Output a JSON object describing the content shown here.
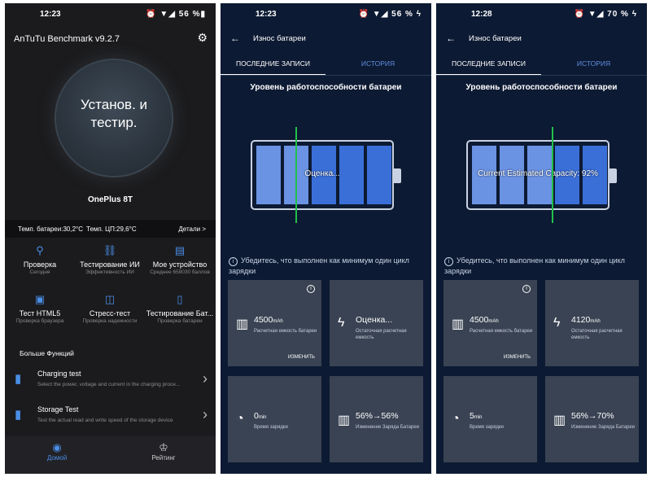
{
  "p1": {
    "time": "12:23",
    "status_right": "⏰ ▼◢ 56 %▮",
    "app_title": "AnTuTu Benchmark v9.2.7",
    "dial_line1": "Установ. и",
    "dial_line2": "тестир.",
    "device": "OnePlus 8T",
    "temp_battery": "Темп. батареи:30,2°C",
    "temp_cpu": "Темп. ЦП:29,6°C",
    "details": "Детали >",
    "tiles": [
      {
        "title": "Проверка",
        "sub": "Сегодня",
        "icon": "search-check-icon"
      },
      {
        "title": "Тестирование ИИ",
        "sub": "Эффективность ИИ",
        "icon": "ai-network-icon"
      },
      {
        "title": "Мое устройство",
        "sub": "Среднее 659030 баллов",
        "icon": "device-icon"
      },
      {
        "title": "Тест HTML5",
        "sub": "Проверка браузера",
        "icon": "html5-icon"
      },
      {
        "title": "Стресс-тест",
        "sub": "Проверка надежности",
        "icon": "stress-icon"
      },
      {
        "title": "Тестирование Бат...",
        "sub": "Проверка батареи",
        "icon": "battery-test-icon"
      }
    ],
    "more_title": "Больше Функций",
    "functions": [
      {
        "title": "Charging test",
        "sub": "Select the power, voltage and current in the charging proce..."
      },
      {
        "title": "Storage Test",
        "sub": "Test the actual read and write speed of the storage device"
      }
    ],
    "nav": [
      {
        "label": "Домой"
      },
      {
        "label": "Рейтинг"
      }
    ]
  },
  "p2": {
    "time": "12:23",
    "status_right": "⏰ ▼◢ 56 % ϟ",
    "title": "Износ батареи",
    "tab1": "ПОСЛЕДНИЕ ЗАПИСИ",
    "tab2": "ИСТОРИЯ",
    "heading": "Уровень работоспособности батареи",
    "battery_label": "Оценка...",
    "note": "Убедитесь, что выполнен как минимум один цикл зарядки",
    "cards": [
      {
        "value": "4500",
        "unit": "mAh",
        "sub": "Расчетная емкость батареи",
        "edit": "ИЗМЕНИТЬ"
      },
      {
        "value": "Оценка...",
        "unit": "",
        "sub": "Остаточная расчетная емкость"
      },
      {
        "value": "0",
        "unit": "min",
        "sub": "Время зарядки"
      },
      {
        "value": "56%→56%",
        "unit": "",
        "sub": "Изменение Заряда Батареи"
      }
    ]
  },
  "p3": {
    "time": "12:28",
    "status_right": "⏰ ▼◢ 70 % ϟ",
    "title": "Износ батареи",
    "tab1": "ПОСЛЕДНИЕ ЗАПИСИ",
    "tab2": "ИСТОРИЯ",
    "heading": "Уровень работоспособности батареи",
    "battery_label": "Current Estimated Capacity: 92%",
    "note": "Убедитесь, что выполнен как минимум один цикл зарядки",
    "cards": [
      {
        "value": "4500",
        "unit": "mAh",
        "sub": "Расчетная емкость батареи",
        "edit": "ИЗМЕНИТЬ"
      },
      {
        "value": "4120",
        "unit": "mAh",
        "sub": "Остаточная расчетная емкость"
      },
      {
        "value": "5",
        "unit": "min",
        "sub": "Время зарядки"
      },
      {
        "value": "56%→70%",
        "unit": "",
        "sub": "Изменение Заряда Батареи"
      }
    ]
  }
}
